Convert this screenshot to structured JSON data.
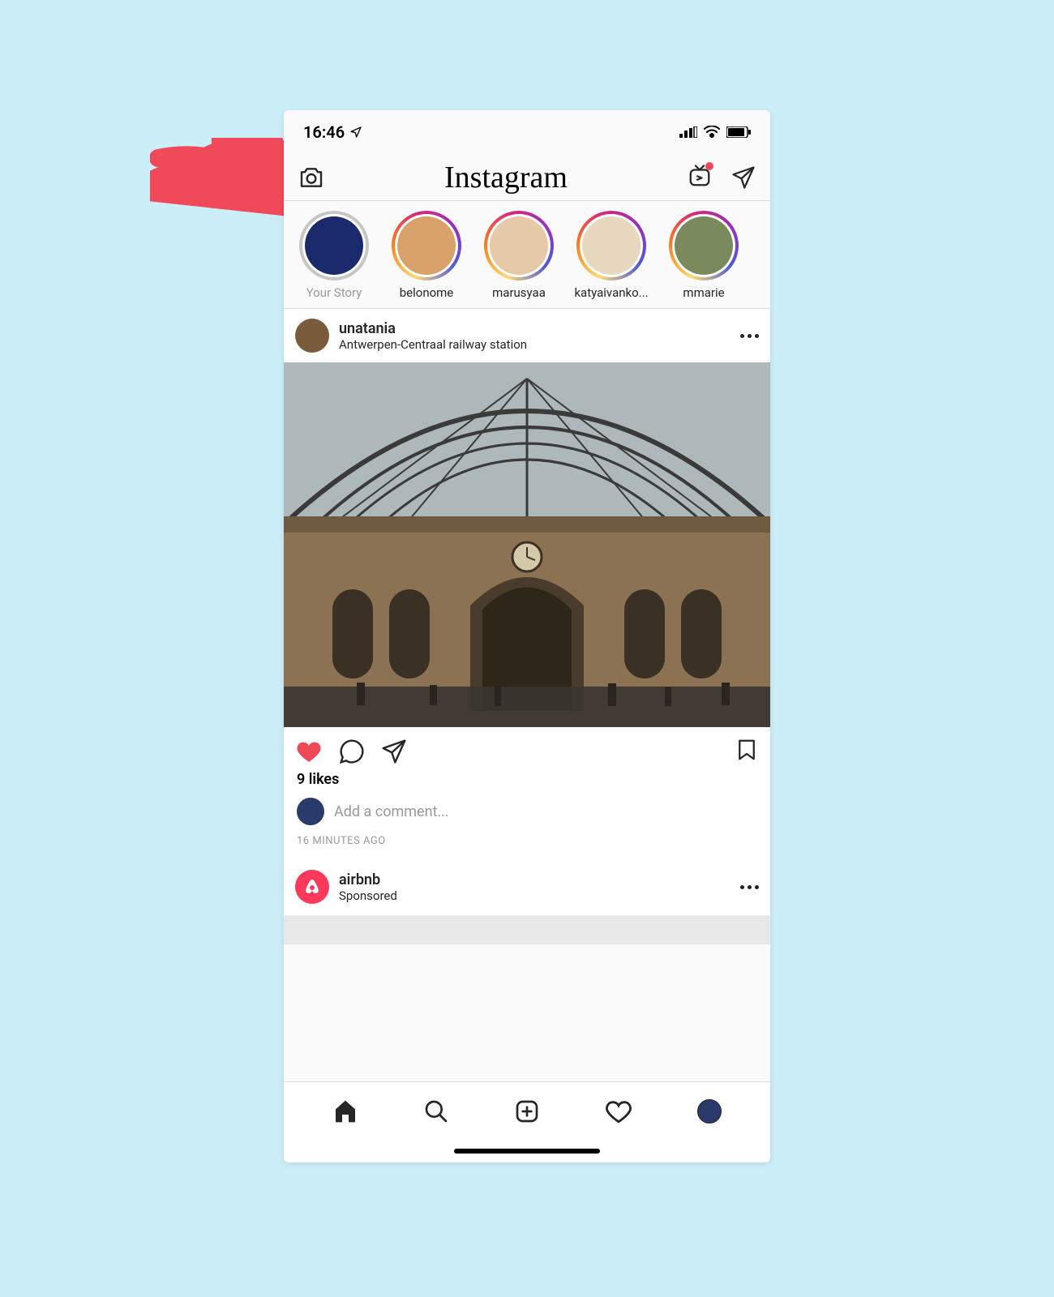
{
  "annotation": {
    "arrow_color": "#f04a5a"
  },
  "status": {
    "time": "16:46"
  },
  "header": {
    "app_name": "Instagram"
  },
  "stories": {
    "items": [
      {
        "label": "Your Story",
        "own": true,
        "bg": "#1a2a6c"
      },
      {
        "label": "belonome",
        "own": false,
        "bg": "#d9a26b"
      },
      {
        "label": "marusyaa",
        "own": false,
        "bg": "#e6c9a8"
      },
      {
        "label": "katyaivanko...",
        "own": false,
        "bg": "#e8d8c0"
      },
      {
        "label": "mmarie",
        "own": false,
        "bg": "#7a8a5c"
      }
    ]
  },
  "post": {
    "username": "unatania",
    "location": "Antwerpen-Centraal railway station",
    "likes_text": "9 likes",
    "comment_placeholder": "Add a comment...",
    "timestamp": "16 MINUTES AGO",
    "liked": true
  },
  "sponsored": {
    "username": "airbnb",
    "subtitle": "Sponsored",
    "brand_color": "#ff385c"
  }
}
